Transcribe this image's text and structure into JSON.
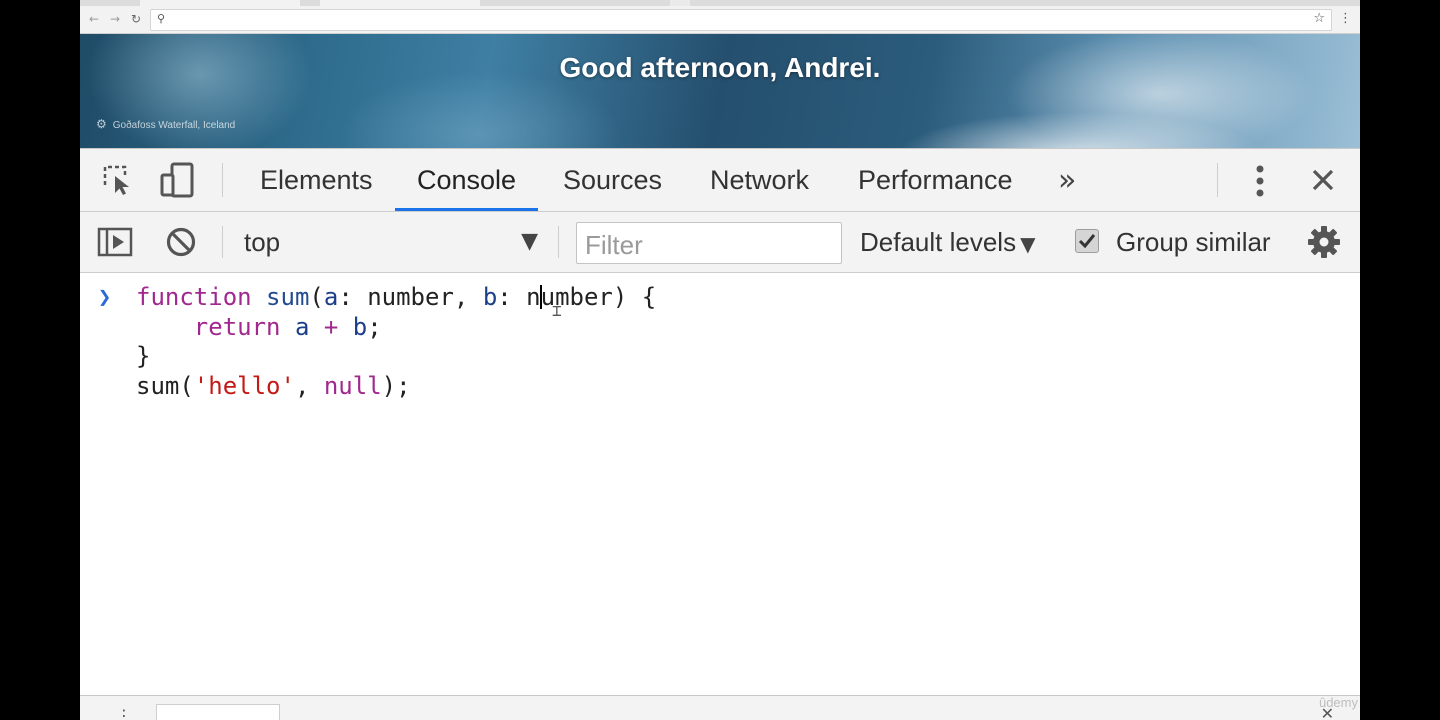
{
  "browser": {
    "back_glyph": "←",
    "forward_glyph": "→",
    "reload_glyph": "↻",
    "search_glyph": "⚲",
    "star_glyph": "☆",
    "menu_glyph": "⋮"
  },
  "banner": {
    "greeting": "Good afternoon, Andrei.",
    "photo_credit": "Goðafoss Waterfall, Iceland"
  },
  "devtools": {
    "tabs": [
      {
        "label": "Elements",
        "active": false
      },
      {
        "label": "Console",
        "active": true
      },
      {
        "label": "Sources",
        "active": false
      },
      {
        "label": "Network",
        "active": false
      },
      {
        "label": "Performance",
        "active": false
      }
    ],
    "overflow_glyph": "»",
    "kebab_glyph": "⋮",
    "close_glyph": "✕",
    "accent_color": "#1a73e8"
  },
  "console_toolbar": {
    "context": "top",
    "dropdown_glyph": "▼",
    "filter_placeholder": "Filter",
    "levels_label": "Default levels",
    "group_similar_label": "Group similar",
    "group_similar_checked": true
  },
  "console": {
    "prompt_glyph": "❯",
    "code_lines": [
      "function sum(a: number, b: number) {",
      "    return a + b;",
      "}",
      "sum('hello', null);"
    ]
  },
  "watermark": "ûdemy"
}
